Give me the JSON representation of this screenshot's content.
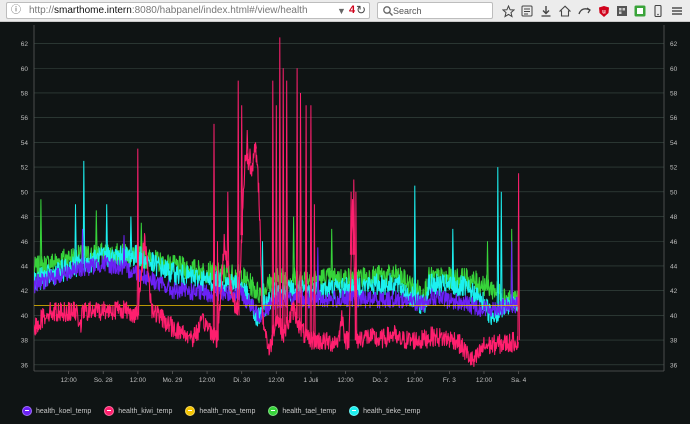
{
  "browser": {
    "url_prefix": "http://",
    "url_host": "smarthome.intern",
    "url_path": ":8080/habpanel/index.html#/view/health",
    "url_badge": "4",
    "search_placeholder": "Search"
  },
  "legend": [
    {
      "label": "health_koel_temp",
      "color": "#6b21f5"
    },
    {
      "label": "health_kiwi_temp",
      "color": "#ff1f6e"
    },
    {
      "label": "health_moa_temp",
      "color": "#f5c400"
    },
    {
      "label": "health_tael_temp",
      "color": "#37d33a"
    },
    {
      "label": "health_tieke_temp",
      "color": "#1cf0f0"
    }
  ],
  "chart_data": {
    "type": "line",
    "y_range": [
      35.5,
      63.5
    ],
    "y_ticks": [
      "36",
      "38",
      "40",
      "42",
      "44",
      "46",
      "48",
      "50",
      "52",
      "54",
      "56",
      "58",
      "60",
      "62"
    ],
    "x_range": [
      0,
      9.1
    ],
    "x_ticks": [
      {
        "x": 0.5,
        "label": "12:00"
      },
      {
        "x": 1.0,
        "label": "So. 28"
      },
      {
        "x": 1.5,
        "label": "12:00"
      },
      {
        "x": 2.0,
        "label": "Mo. 29"
      },
      {
        "x": 2.5,
        "label": "12:00"
      },
      {
        "x": 3.0,
        "label": "Di. 30"
      },
      {
        "x": 3.5,
        "label": "12:00"
      },
      {
        "x": 4.0,
        "label": "1 Juli"
      },
      {
        "x": 4.5,
        "label": "12:00"
      },
      {
        "x": 5.0,
        "label": "Do. 2"
      },
      {
        "x": 5.5,
        "label": "12:00"
      },
      {
        "x": 6.0,
        "label": "Fr. 3"
      },
      {
        "x": 6.5,
        "label": "12:00"
      },
      {
        "x": 7.0,
        "label": "Sa. 4"
      }
    ],
    "grid": true,
    "legend_position": "bottom-left",
    "series": [
      {
        "name": "health_tael_temp",
        "color": "#37d33a",
        "noise": 0.9,
        "spikes": [
          [
            0.1,
            49.4
          ],
          [
            0.9,
            48.5
          ],
          [
            1.55,
            47.5
          ],
          [
            3.75,
            48
          ],
          [
            4.3,
            47
          ],
          [
            6.55,
            46
          ],
          [
            6.9,
            47
          ]
        ],
        "points": [
          [
            0,
            43.8
          ],
          [
            0.5,
            44.7
          ],
          [
            1.0,
            45.0
          ],
          [
            1.5,
            44.8
          ],
          [
            2.0,
            44.0
          ],
          [
            2.5,
            43.5
          ],
          [
            3.0,
            43.2
          ],
          [
            3.25,
            41.8
          ],
          [
            3.5,
            43.0
          ],
          [
            4.0,
            43.0
          ],
          [
            4.5,
            43.0
          ],
          [
            5.0,
            43.2
          ],
          [
            5.25,
            43.2
          ],
          [
            5.55,
            42.0
          ],
          [
            5.65,
            42.0
          ],
          [
            5.7,
            43.0
          ],
          [
            6.2,
            43.0
          ],
          [
            6.5,
            42.5
          ],
          [
            7.0,
            41.0
          ]
        ]
      },
      {
        "name": "health_tieke_temp",
        "color": "#1cf0f0",
        "noise": 0.9,
        "spikes": [
          [
            0.6,
            49
          ],
          [
            0.72,
            52.5
          ],
          [
            1.05,
            49
          ],
          [
            1.4,
            48
          ],
          [
            3.3,
            46
          ],
          [
            5.5,
            50.5
          ],
          [
            6.05,
            47
          ],
          [
            6.7,
            52
          ],
          [
            6.75,
            50
          ]
        ],
        "points": [
          [
            0,
            42.8
          ],
          [
            0.5,
            43.8
          ],
          [
            1.0,
            44.7
          ],
          [
            1.5,
            44.8
          ],
          [
            2.0,
            43.4
          ],
          [
            2.5,
            42.8
          ],
          [
            3.0,
            42.5
          ],
          [
            3.22,
            39.6
          ],
          [
            3.3,
            40.5
          ],
          [
            3.5,
            42.0
          ],
          [
            4.0,
            42.0
          ],
          [
            4.5,
            42.3
          ],
          [
            5.0,
            42.5
          ],
          [
            5.25,
            42.5
          ],
          [
            5.55,
            41.0
          ],
          [
            5.65,
            41.0
          ],
          [
            5.7,
            42.5
          ],
          [
            6.2,
            42.3
          ],
          [
            6.5,
            41.0
          ],
          [
            6.6,
            40.0
          ],
          [
            7.0,
            41.2
          ]
        ]
      },
      {
        "name": "health_koel_temp",
        "color": "#6b21f5",
        "noise": 0.7,
        "spikes": [
          [
            0.7,
            47
          ],
          [
            1.3,
            46.5
          ],
          [
            4.1,
            45.5
          ],
          [
            6.9,
            46
          ]
        ],
        "points": [
          [
            0,
            42.5
          ],
          [
            0.5,
            43.5
          ],
          [
            1.0,
            44.2
          ],
          [
            1.5,
            43.5
          ],
          [
            2.0,
            42.0
          ],
          [
            2.5,
            41.8
          ],
          [
            3.0,
            41.7
          ],
          [
            3.25,
            40.0
          ],
          [
            3.5,
            41.3
          ],
          [
            4.0,
            41.3
          ],
          [
            4.5,
            41.3
          ],
          [
            5.0,
            41.3
          ],
          [
            5.25,
            41.3
          ],
          [
            5.55,
            41.0
          ],
          [
            5.65,
            41.0
          ],
          [
            5.7,
            41.5
          ],
          [
            6.2,
            41.0
          ],
          [
            6.5,
            40.5
          ],
          [
            7.0,
            40.8
          ]
        ]
      },
      {
        "name": "health_moa_temp",
        "color": "#f5c400",
        "noise": 0,
        "spikes": [],
        "points": [
          [
            0,
            40.8
          ],
          [
            7.0,
            40.8
          ]
        ]
      },
      {
        "name": "health_kiwi_temp",
        "color": "#ff1f6e",
        "noise": 0.8,
        "spikes": [
          [
            1.5,
            53.5
          ],
          [
            2.6,
            55.5
          ],
          [
            2.65,
            46
          ],
          [
            2.8,
            50
          ],
          [
            2.95,
            59
          ],
          [
            3.0,
            57
          ],
          [
            3.08,
            55
          ],
          [
            3.12,
            53.5
          ],
          [
            3.2,
            54
          ],
          [
            3.45,
            59
          ],
          [
            3.5,
            57
          ],
          [
            3.55,
            62.5
          ],
          [
            3.6,
            60
          ],
          [
            3.65,
            59
          ],
          [
            3.8,
            60
          ],
          [
            3.85,
            58
          ],
          [
            3.93,
            57
          ],
          [
            4.0,
            57
          ],
          [
            4.05,
            49
          ],
          [
            4.58,
            50
          ],
          [
            4.62,
            51
          ],
          [
            4.65,
            50
          ],
          [
            7.0,
            51.5
          ]
        ],
        "points": [
          [
            0,
            39.0
          ],
          [
            0.2,
            40.3
          ],
          [
            0.6,
            40.3
          ],
          [
            0.68,
            39.3
          ],
          [
            0.7,
            40.3
          ],
          [
            1.3,
            40.5
          ],
          [
            1.5,
            40.0
          ],
          [
            1.6,
            46.5
          ],
          [
            1.7,
            40.5
          ],
          [
            2.0,
            39.0
          ],
          [
            2.3,
            38.2
          ],
          [
            2.45,
            39.5
          ],
          [
            2.6,
            38.5
          ],
          [
            2.65,
            38.0
          ],
          [
            2.75,
            46.0
          ],
          [
            2.85,
            42.0
          ],
          [
            2.95,
            40.0
          ],
          [
            3.05,
            53.0
          ],
          [
            3.15,
            52.0
          ],
          [
            3.2,
            53.5
          ],
          [
            3.25,
            50.0
          ],
          [
            3.3,
            40.0
          ],
          [
            3.4,
            37.0
          ],
          [
            3.5,
            40.0
          ],
          [
            3.6,
            38.5
          ],
          [
            3.75,
            40.5
          ],
          [
            3.85,
            39.0
          ],
          [
            3.95,
            38.0
          ],
          [
            4.05,
            38.0
          ],
          [
            4.3,
            37.8
          ],
          [
            4.4,
            38.0
          ],
          [
            4.45,
            40.0
          ],
          [
            4.5,
            38.0
          ],
          [
            4.55,
            38.0
          ],
          [
            4.6,
            49.5
          ],
          [
            4.65,
            38.0
          ],
          [
            4.8,
            38.3
          ],
          [
            5.0,
            38.0
          ],
          [
            5.2,
            38.5
          ],
          [
            5.25,
            38.0
          ],
          [
            5.4,
            38.0
          ],
          [
            5.6,
            38.0
          ],
          [
            5.75,
            38.3
          ],
          [
            6.1,
            38.0
          ],
          [
            6.35,
            36.2
          ],
          [
            6.5,
            37.5
          ],
          [
            6.9,
            37.8
          ],
          [
            7.0,
            38.0
          ]
        ]
      }
    ]
  }
}
